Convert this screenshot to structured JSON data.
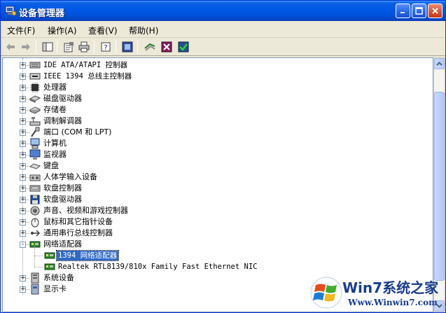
{
  "window": {
    "title": "设备管理器"
  },
  "menu": [
    {
      "label": "文件(F)"
    },
    {
      "label": "操作(A)"
    },
    {
      "label": "查看(V)"
    },
    {
      "label": "帮助(H)"
    }
  ],
  "tree": [
    {
      "label": "IDE ATA/ATAPI 控制器",
      "icon": "ide-controller-icon",
      "expander": "+"
    },
    {
      "label": "IEEE 1394 总线主控制器",
      "icon": "ieee1394-icon",
      "expander": "+"
    },
    {
      "label": "处理器",
      "icon": "processor-icon",
      "expander": "+"
    },
    {
      "label": "磁盘驱动器",
      "icon": "disk-drive-icon",
      "expander": "+"
    },
    {
      "label": "存储卷",
      "icon": "storage-volume-icon",
      "expander": "+"
    },
    {
      "label": "调制解调器",
      "icon": "modem-icon",
      "expander": "+"
    },
    {
      "label": "端口 (COM 和 LPT)",
      "icon": "port-icon",
      "expander": "+"
    },
    {
      "label": "计算机",
      "icon": "computer-icon",
      "expander": "+"
    },
    {
      "label": "监视器",
      "icon": "monitor-icon",
      "expander": "+"
    },
    {
      "label": "键盘",
      "icon": "keyboard-icon",
      "expander": "+"
    },
    {
      "label": "人体学输入设备",
      "icon": "hid-icon",
      "expander": "+"
    },
    {
      "label": "软盘控制器",
      "icon": "floppy-controller-icon",
      "expander": "+"
    },
    {
      "label": "软盘驱动器",
      "icon": "floppy-drive-icon",
      "expander": "+"
    },
    {
      "label": "声音、视频和游戏控制器",
      "icon": "sound-icon",
      "expander": "+"
    },
    {
      "label": "鼠标和其它指针设备",
      "icon": "mouse-icon",
      "expander": "+"
    },
    {
      "label": "通用串行总线控制器",
      "icon": "usb-icon",
      "expander": "+"
    },
    {
      "label": "网络适配器",
      "icon": "network-adapter-icon",
      "expander": "-"
    },
    {
      "label": "1394 网络适配器",
      "icon": "network-card-icon",
      "child": true,
      "selected": true
    },
    {
      "label": "Realtek RTL8139/810x Family Fast Ethernet NIC",
      "icon": "network-card-icon",
      "child": true
    },
    {
      "label": "系统设备",
      "icon": "system-device-icon",
      "expander": "+"
    },
    {
      "label": "显示卡",
      "icon": "display-adapter-icon",
      "expander": "+"
    }
  ],
  "watermark": {
    "logo_text": "Win7系统之家",
    "url": "Www.Winwin7.com"
  },
  "colors": {
    "title_blue": "#0058e6",
    "selection": "#316ac5",
    "close_red": "#d9502c"
  }
}
